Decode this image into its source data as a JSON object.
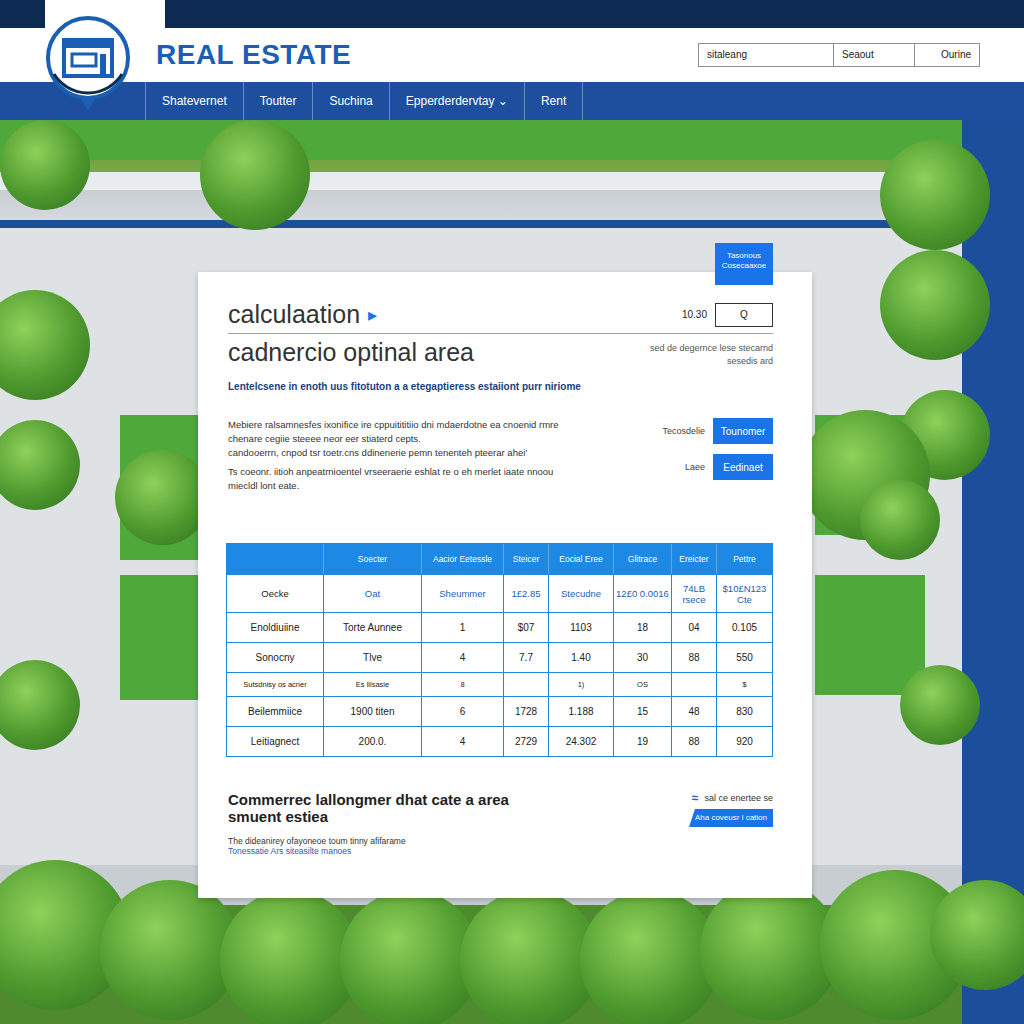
{
  "brand": {
    "name": "REAL ESTATE"
  },
  "header_links": [
    "sitaleang",
    "Seaout",
    "Ourine"
  ],
  "nav": [
    "Shatevernet",
    "Toutter",
    "Suchina",
    "Epperderdervtay ⌄",
    "Rent"
  ],
  "card": {
    "badge": "Tasonous Cosecaaxoe",
    "title": "calculaation",
    "title_icon": "▸",
    "value": "10.30",
    "search_button": "Q",
    "subtitle": "cadnercio optinal area",
    "side_note": "sed de degernce lese stecarnd sesedis ard",
    "lead": "Lentelcsene in enoth uus fitotuton a a etegaptieress estaiiont purr niriome",
    "paragraph": [
      "Mebiere ralsamnesfes ixonifice ire cppuitititiio dni mdaerdotne ea cnoenid rmre",
      "chenare cegiie steeee neor eer stiaterd cepts.",
      "candooerrn, cnpod tsr toetr.cns ddinenerie pemn tenenteh pteerar ahei'",
      "Ts coeonr. iitioh anpeatrnioentel vrseeraerie eshlat re o eh merlet iaate nnoou",
      "miecldl lont eate."
    ],
    "actions": [
      {
        "label": "Tecosdelie",
        "button": "Tounomer"
      },
      {
        "label": "Laee",
        "button": "Eedinaet"
      }
    ]
  },
  "table": {
    "columns": [
      "",
      "Soecter",
      "Aacior Eetessle",
      "Steicer",
      "Eocial Eree",
      "Glitrace",
      "Ereicter",
      "Pettre"
    ],
    "subheader": [
      "Oecke",
      "Oat",
      "Sheummer",
      "1£2.85",
      "Stecudne",
      "12£0 0.0016",
      "74LB rsece",
      "$10£N123 Cte"
    ],
    "rows": [
      {
        "kind": "normal",
        "cells": [
          "Enoldiuiine",
          "Torte Aunnee",
          "1",
          "$07",
          "1103",
          "18",
          "04",
          "0.105"
        ]
      },
      {
        "kind": "normal",
        "cells": [
          "Sonocny",
          "Tlve",
          "4",
          "7.7",
          "1.40",
          "30",
          "88",
          "550"
        ]
      },
      {
        "kind": "small",
        "cells": [
          "Sutsdnisy os acner",
          "Es lilsasie",
          "8",
          "",
          "1)",
          "OS",
          "",
          "$"
        ]
      },
      {
        "kind": "normal",
        "cells": [
          "Beilemmiice",
          "1900 titen",
          "6",
          "1728",
          "1.188",
          "15",
          "48",
          "830"
        ]
      },
      {
        "kind": "normal",
        "cells": [
          "Leitiagnect",
          "200.0.",
          "4",
          "2729",
          "24.302",
          "19",
          "88",
          "920"
        ]
      }
    ]
  },
  "footer": {
    "title": [
      "Commerrec lallongmer dhat cate a area",
      "smuent estiea"
    ],
    "text": "The dideanirey ofayoneoe toum tinny afifarame",
    "link": "Tonessatie Ars siteasilte manoes",
    "note_icon": "≈",
    "note": "sal ce enertee se",
    "badge": "Aha coveusr l cation"
  }
}
